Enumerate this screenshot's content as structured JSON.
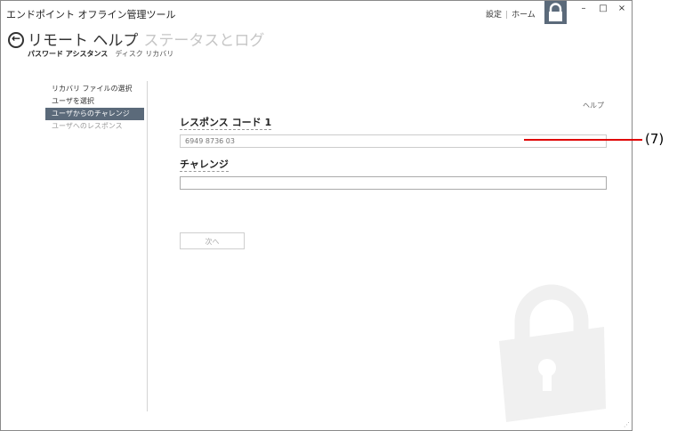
{
  "app": {
    "title": "エンドポイント オフライン管理ツール",
    "settings_link": "設定",
    "link_separator": "|",
    "home_link": "ホーム"
  },
  "window_controls": {
    "minimize": "–",
    "maximize": "□",
    "close": "×"
  },
  "header": {
    "back_glyph": "←",
    "title": "リモート ヘルプ",
    "title_secondary": "ステータスとログ"
  },
  "subnav": {
    "active": "パスワード アシスタンス",
    "inactive": "ディスク リカバリ"
  },
  "sidebar": {
    "items": [
      {
        "label": "リカバリ ファイルの選択",
        "state": "normal"
      },
      {
        "label": "ユーザを選択",
        "state": "normal"
      },
      {
        "label": "ユーザからのチャレンジ",
        "state": "selected"
      },
      {
        "label": "ユーザへのレスポンス",
        "state": "disabled"
      }
    ]
  },
  "main": {
    "help_link": "ヘルプ",
    "response_label": "レスポンス コード 1",
    "response_value": "6949 8736 03",
    "challenge_label": "チャレンジ",
    "challenge_value": "",
    "next_button": "次へ"
  },
  "annotation": {
    "label": "(7)",
    "color": "#e00000"
  },
  "colors": {
    "accent": "#5b6a7a",
    "watermark": "#f0f0f0"
  }
}
